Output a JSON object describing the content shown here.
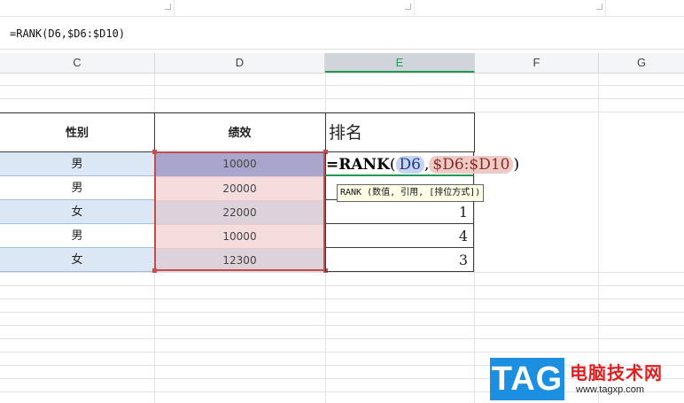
{
  "formula_bar": {
    "text": "=RANK(D6,$D6:$D10)"
  },
  "columns": [
    "C",
    "D",
    "E",
    "F",
    "G"
  ],
  "active_column": "E",
  "table": {
    "headers": {
      "gender": "性别",
      "performance": "绩效",
      "rank": "排名"
    },
    "rows": [
      {
        "gender": "男",
        "performance": "10000",
        "rank": ""
      },
      {
        "gender": "男",
        "performance": "20000",
        "rank": ""
      },
      {
        "gender": "女",
        "performance": "22000",
        "rank": "1"
      },
      {
        "gender": "男",
        "performance": "10000",
        "rank": "4"
      },
      {
        "gender": "女",
        "performance": "12300",
        "rank": "3"
      }
    ]
  },
  "cell_formula": {
    "prefix": "=RANK",
    "open": "(",
    "ref1": "D6",
    "sep": ",",
    "ref2": "$D6:$D10",
    "close": ")"
  },
  "tooltip": {
    "text": "RANK (数值, 引用, [排位方式])"
  },
  "watermark": {
    "tag": "TAG",
    "site_name": "电脑技术网",
    "url": "www.tagxp.com"
  },
  "colors": {
    "c_col_fill": "#dbe7f4",
    "range_outline": "#c0504d",
    "selected_cell": "#aaa5cc",
    "row_pink": "#f5dddd",
    "row_mauve": "#ddd1da",
    "active_header_green": "#1e9a55",
    "watermark_blue": "#1d8fe0",
    "watermark_red": "#e02020"
  }
}
